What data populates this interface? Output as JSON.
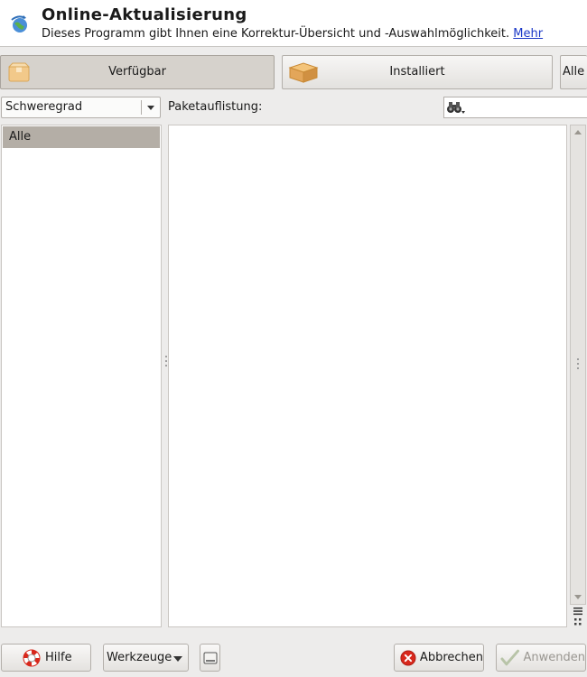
{
  "header": {
    "title": "Online-Aktualisierung",
    "subtitle": "Dieses Programm gibt Ihnen eine Korrektur-Übersicht und -Auswahlmöglichkeit.",
    "more_link": "Mehr",
    "icon": "update-globe-icon"
  },
  "tabs": [
    {
      "label": "Verfügbar",
      "icon": "package-open-icon",
      "selected": true
    },
    {
      "label": "Installiert",
      "icon": "package-box-icon",
      "selected": false
    },
    {
      "label": "Alle",
      "selected": false
    }
  ],
  "filter": {
    "severity_value": "Schweregrad",
    "package_list_label": "Paketauflistung:",
    "search_value": "",
    "search_icon": "binoculars-icon"
  },
  "categories": [
    {
      "label": "Alle",
      "selected": true
    }
  ],
  "package_list": [],
  "buttons": {
    "help": "Hilfe",
    "tools": "Werkzeuge",
    "cancel": "Abbrechen",
    "apply": "Anwenden",
    "apply_enabled": false
  },
  "colors": {
    "selection": "#b4aea6",
    "link": "#1a37c7",
    "cancel_red": "#d8281c"
  }
}
